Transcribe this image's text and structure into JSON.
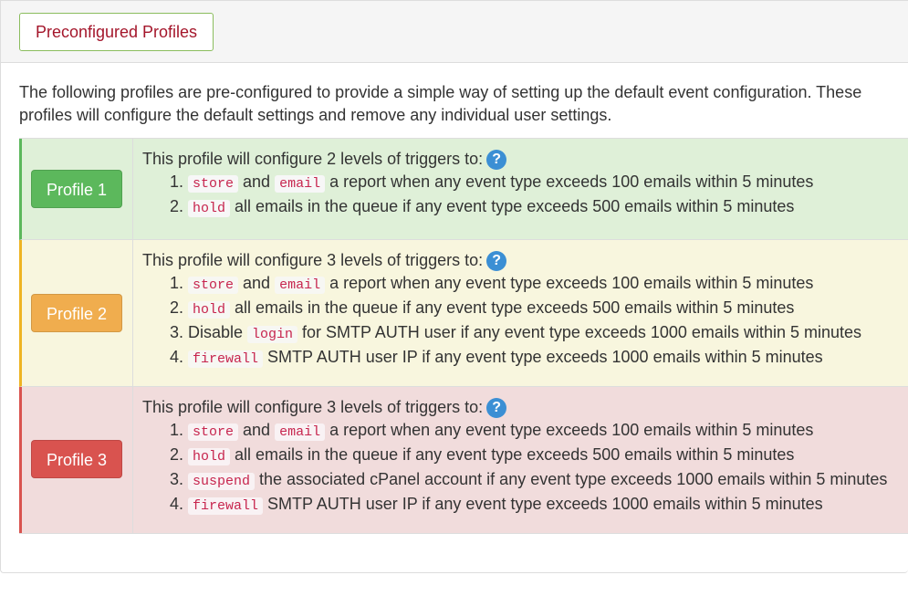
{
  "header": {
    "button_label": "Preconfigured Profiles"
  },
  "intro": "The following profiles are pre-configured to provide a simple way of setting up the default event configuration. These profiles will configure the default settings and remove any individual user settings.",
  "profiles": [
    {
      "button": "Profile 1",
      "title": "This profile will configure 2 levels of triggers to:",
      "items": [
        {
          "num": "1.",
          "c1": "store",
          "t1": " and ",
          "c2": "email",
          "t2": " a report when any event type exceeds 100 emails within 5 minutes"
        },
        {
          "num": "2.",
          "c1": "hold",
          "t1": " all emails in the queue if any event type exceeds 500 emails within 5 minutes"
        }
      ]
    },
    {
      "button": "Profile 2",
      "title": "This profile will configure 3 levels of triggers to:",
      "items": [
        {
          "num": "1.",
          "c1": "store",
          "t1": " and ",
          "c2": "email",
          "t2": " a report when any event type exceeds 100 emails within 5 minutes"
        },
        {
          "num": "2.",
          "c1": "hold",
          "t1": " all emails in the queue if any event type exceeds 500 emails within 5 minutes"
        },
        {
          "num": "3.",
          "t0": "Disable ",
          "c1": "login",
          "t1": " for SMTP AUTH user if any event type exceeds 1000 emails within 5 minutes"
        },
        {
          "num": "4.",
          "c1": "firewall",
          "t1": " SMTP AUTH user IP if any event type exceeds 1000 emails within 5 minutes"
        }
      ]
    },
    {
      "button": "Profile 3",
      "title": "This profile will configure 3 levels of triggers to:",
      "items": [
        {
          "num": "1.",
          "c1": "store",
          "t1": " and ",
          "c2": "email",
          "t2": " a report when any event type exceeds 100 emails within 5 minutes"
        },
        {
          "num": "2.",
          "c1": "hold",
          "t1": " all emails in the queue if any event type exceeds 500 emails within 5 minutes"
        },
        {
          "num": "3.",
          "c1": "suspend",
          "t1": " the associated cPanel account if any event type exceeds 1000 emails within 5 minutes"
        },
        {
          "num": "4.",
          "c1": "firewall",
          "t1": " SMTP AUTH user IP if any event type exceeds 1000 emails within 5 minutes"
        }
      ]
    }
  ],
  "help_glyph": "?",
  "icons": {
    "help": "question-circle-icon"
  },
  "colors": {
    "success": "#5cb85c",
    "warning": "#f0ad4e",
    "danger": "#d9534f",
    "code": "#c7254e",
    "help": "#3b8fd4"
  }
}
